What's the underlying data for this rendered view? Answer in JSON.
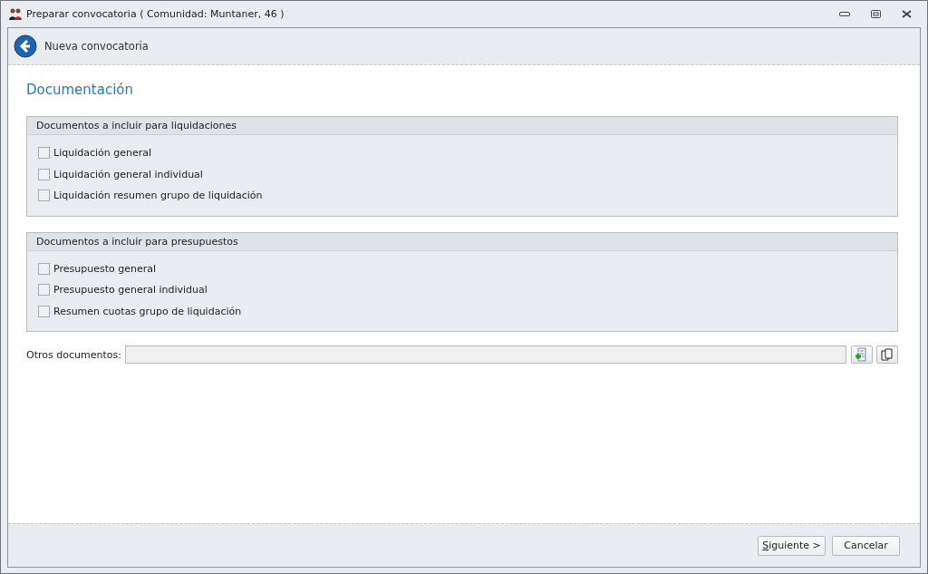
{
  "window": {
    "title": "Preparar convocatoria ( Comunidad: Muntaner, 46 )"
  },
  "header": {
    "title": "Nueva convocatoria"
  },
  "section_title": "Documentación",
  "groups": [
    {
      "title": "Documentos a incluir para liquidaciones",
      "items": [
        {
          "label": "Liquidación general",
          "checked": false
        },
        {
          "label": "Liquidación general individual",
          "checked": false
        },
        {
          "label": "Liquidación resumen grupo de liquidación",
          "checked": false
        }
      ]
    },
    {
      "title": "Documentos a incluir para presupuestos",
      "items": [
        {
          "label": "Presupuesto general",
          "checked": false
        },
        {
          "label": "Presupuesto general individual",
          "checked": false
        },
        {
          "label": "Resumen cuotas grupo de liquidación",
          "checked": false
        }
      ]
    }
  ],
  "other_documents": {
    "label": "Otros documentos:"
  },
  "buttons": [
    {
      "label": "Siguiente >",
      "mnemonic": true
    },
    {
      "label": "Cancelar",
      "mnemonic": false
    }
  ]
}
